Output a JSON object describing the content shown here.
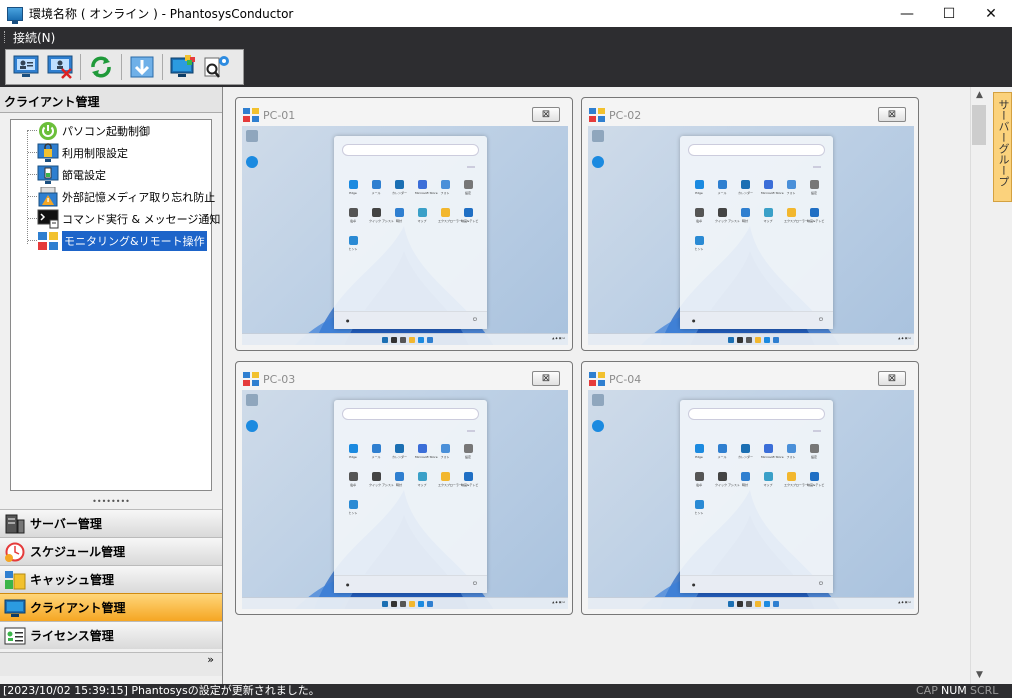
{
  "window": {
    "title": "環境名称 ( オンライン ) - PhantosysConductor",
    "minimize": "—",
    "maximize": "☐",
    "close": "✕"
  },
  "menu": {
    "connect": "接続(N)"
  },
  "toolbar": {
    "icons": [
      "client-list-icon",
      "client-delete-icon",
      "refresh-icon",
      "download-icon",
      "monitor-icon",
      "search-settings-icon"
    ]
  },
  "left_panel": {
    "header": "クライアント管理",
    "tree": [
      {
        "label": "パソコン起動制御",
        "icon": "power-icon"
      },
      {
        "label": "利用制限設定",
        "icon": "lock-icon"
      },
      {
        "label": "節電設定",
        "icon": "battery-icon"
      },
      {
        "label": "外部記憶メディア取り忘れ防止",
        "icon": "usb-warning-icon"
      },
      {
        "label": "コマンド実行 & メッセージ通知",
        "icon": "command-icon"
      },
      {
        "label": "モニタリング&リモート操作",
        "icon": "monitoring-icon"
      }
    ],
    "splitter": "••••••••",
    "nav": [
      {
        "label": "サーバー管理",
        "icon": "server-icon"
      },
      {
        "label": "スケジュール管理",
        "icon": "schedule-icon"
      },
      {
        "label": "キャッシュ管理",
        "icon": "cache-icon"
      },
      {
        "label": "クライアント管理",
        "icon": "client-icon"
      },
      {
        "label": "ライセンス管理",
        "icon": "license-icon"
      }
    ],
    "footer": "»"
  },
  "server_group_tab": "サーバーグループ",
  "monitors": [
    {
      "name": "PC-01",
      "close": "⊠"
    },
    {
      "name": "PC-02",
      "close": "⊠"
    },
    {
      "name": "PC-03",
      "close": "⊠"
    },
    {
      "name": "PC-04",
      "close": "⊠"
    }
  ],
  "status": {
    "message": "[2023/10/02 15:39:15] Phantosysの設定が更新されました。",
    "cap": "CAP",
    "num": "NUM",
    "scrl": "SCRL"
  },
  "colors": {
    "accent": "#1d64c9",
    "active_nav": "#f5a623",
    "dark_bar": "#2d2d30"
  }
}
